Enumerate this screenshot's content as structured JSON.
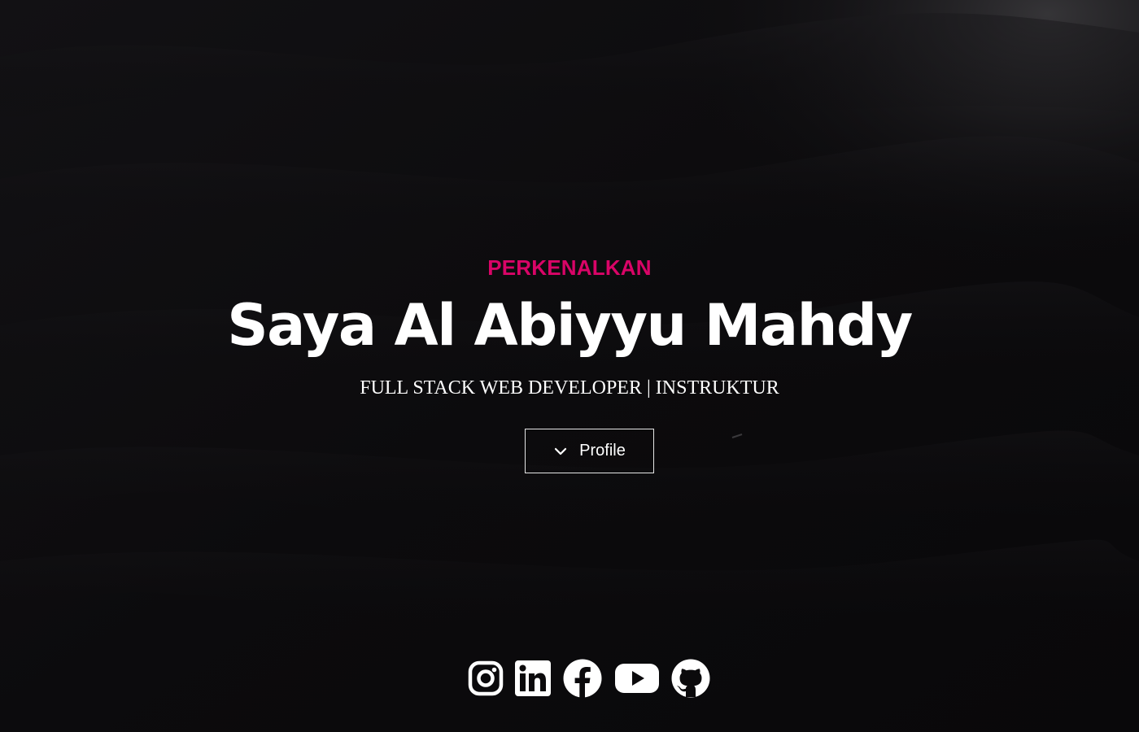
{
  "hero": {
    "kicker": "PERKENALKAN",
    "name": "Saya Al Abiyyu Mahdy",
    "subtitle": "FULL STACK WEB DEVELOPER | INSTRUKTUR",
    "cta": {
      "label": "Profile",
      "icon": "chevron-down-icon"
    }
  },
  "socials": [
    {
      "icon": "instagram-icon"
    },
    {
      "icon": "linkedin-icon"
    },
    {
      "icon": "facebook-icon"
    },
    {
      "icon": "youtube-icon"
    },
    {
      "icon": "github-icon"
    }
  ],
  "colors": {
    "background": "#0b0a0c",
    "accent": "#d90467",
    "text": "#ffffff",
    "button_border": "#e6e6e6"
  }
}
